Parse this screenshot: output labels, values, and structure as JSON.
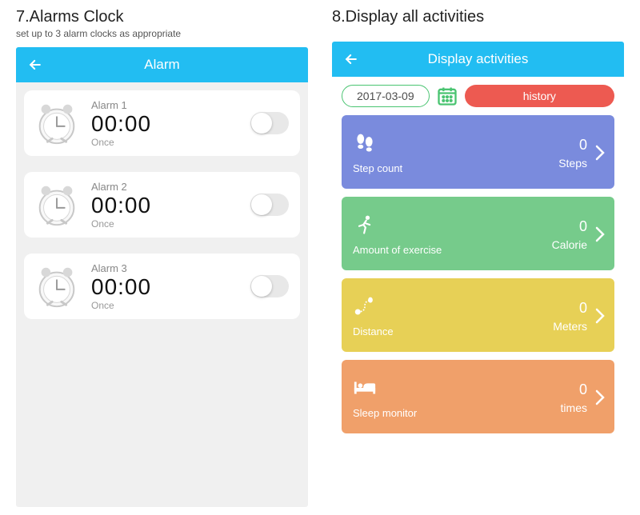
{
  "left": {
    "section_title": "7.Alarms Clock",
    "section_subtitle": "set up to 3 alarm clocks as appropriate",
    "screen_title": "Alarm",
    "alarms": [
      {
        "name": "Alarm 1",
        "time": "00:00",
        "repeat": "Once"
      },
      {
        "name": "Alarm 2",
        "time": "00:00",
        "repeat": "Once"
      },
      {
        "name": "Alarm 3",
        "time": "00:00",
        "repeat": "Once"
      }
    ]
  },
  "right": {
    "section_title": "8.Display all activities",
    "screen_title": "Display activities",
    "date": "2017-03-09",
    "history_label": "history",
    "activities": [
      {
        "label": "Step count",
        "value": "0",
        "unit": "Steps",
        "color": "steps"
      },
      {
        "label": "Amount of exercise",
        "value": "0",
        "unit": "Calorie",
        "color": "exercise"
      },
      {
        "label": "Distance",
        "value": "0",
        "unit": "Meters",
        "color": "distance"
      },
      {
        "label": "Sleep monitor",
        "value": "0",
        "unit": "times",
        "color": "sleep"
      }
    ]
  }
}
